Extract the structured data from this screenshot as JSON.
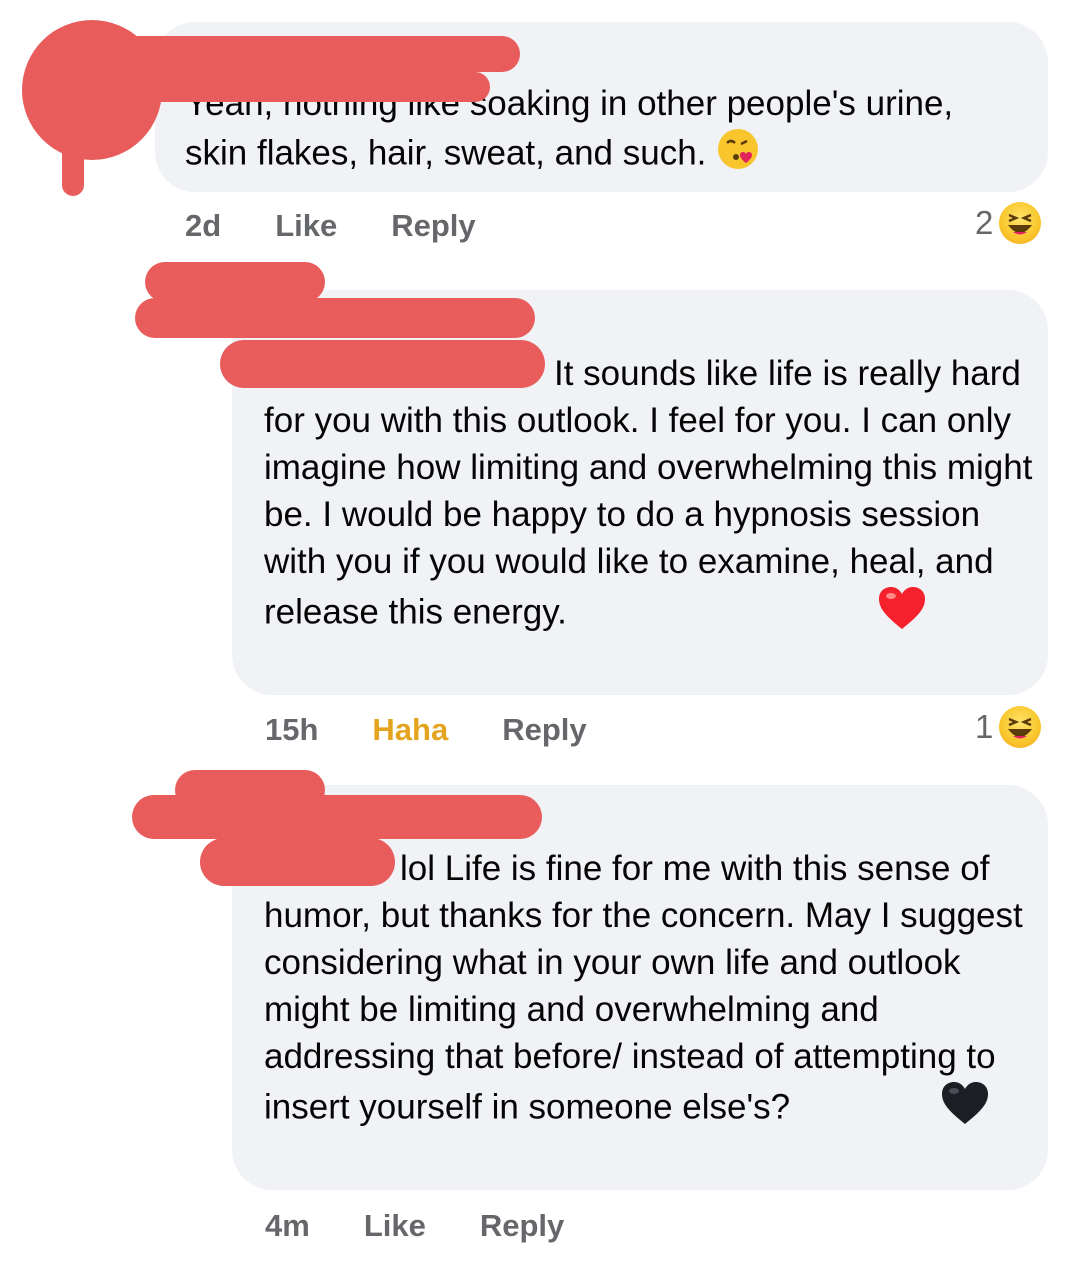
{
  "comments": [
    {
      "text": "Yeah, nothing like soaking in other people's urine, skin flakes, hair, sweat, and such.",
      "time": "2d",
      "action_like": "Like",
      "action_reply": "Reply",
      "reaction_count": "2",
      "reaction_icon": "haha-icon",
      "trailing_emoji": "kiss-heart-emoji"
    },
    {
      "text": "It sounds like life is really hard for you with this outlook.  I feel for you. I can only imagine how limiting and overwhelming this might be.  I would be happy to do a hypnosis session with you if you would like to examine, heal, and release this energy.",
      "time": "15h",
      "action_like": "Haha",
      "action_reply": "Reply",
      "reaction_count": "1",
      "reaction_icon": "haha-icon",
      "trailing_emoji": "red-heart-emoji"
    },
    {
      "text": "lol Life is fine for me with this sense of humor, but thanks for the concern. May I suggest considering what in your own life and outlook might be limiting and overwhelming and addressing that before/ instead of attempting to insert yourself in someone else's?",
      "time": "4m",
      "action_like": "Like",
      "action_reply": "Reply",
      "trailing_emoji": "black-heart-emoji"
    }
  ],
  "colors": {
    "bubble": "#f0f2f5",
    "meta": "#65676b",
    "haha_accent": "#e5a41f",
    "redaction": "#e85c5c"
  }
}
